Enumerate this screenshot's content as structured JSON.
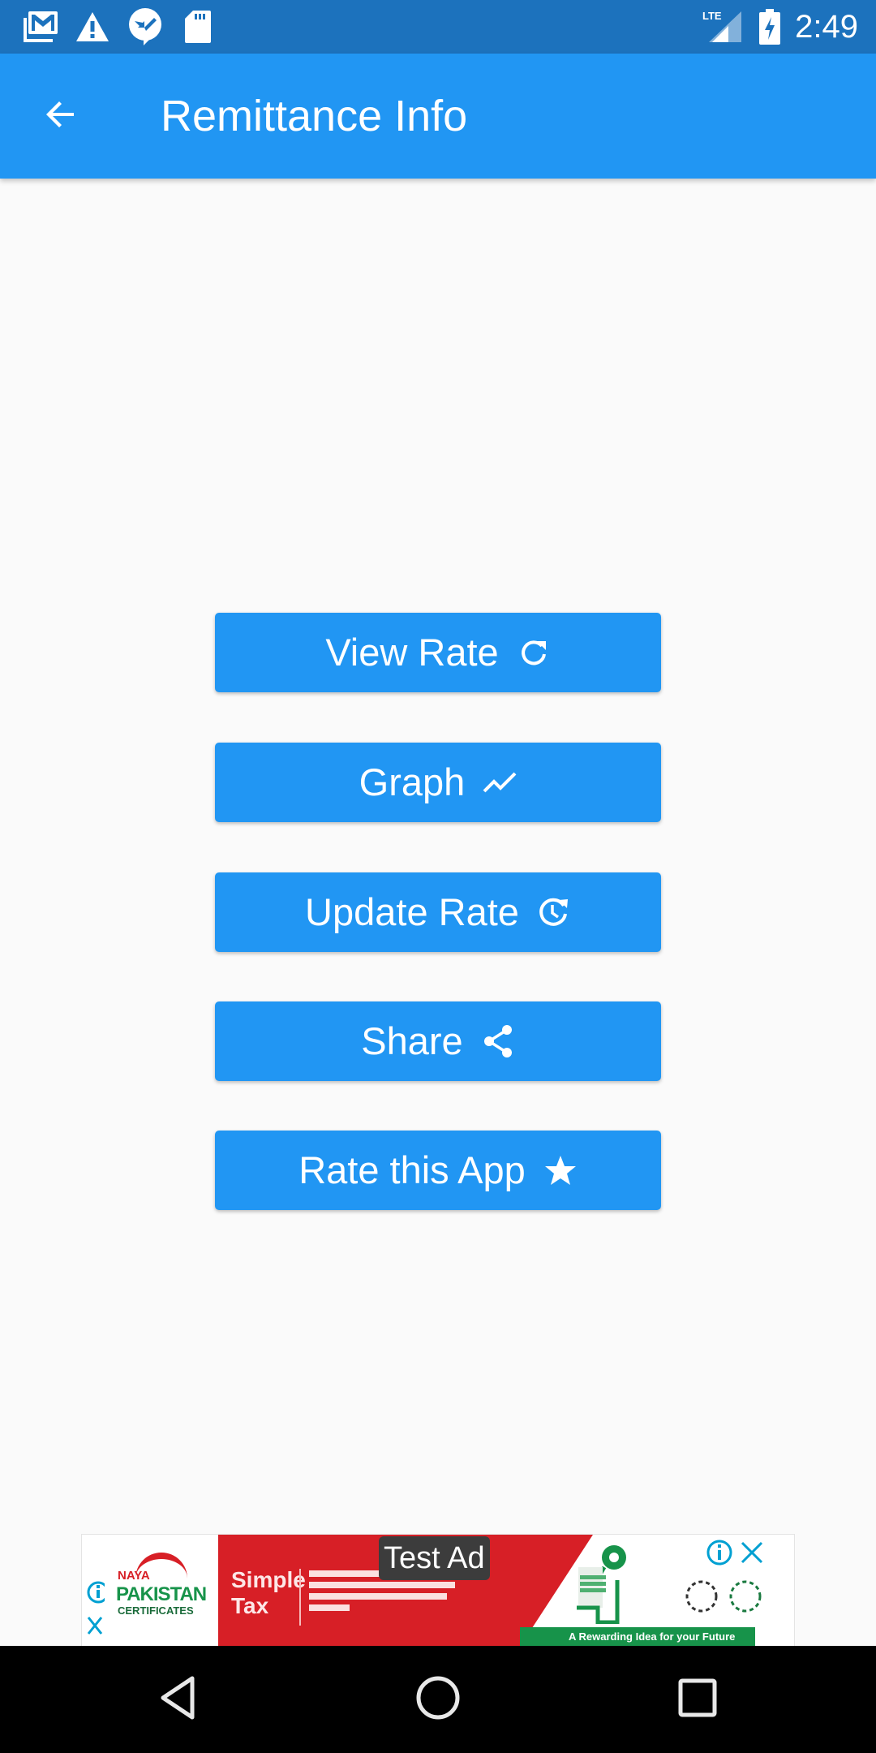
{
  "status_bar": {
    "time": "2:49",
    "network": "LTE",
    "notification_icons": [
      "gmail-icon",
      "warning-icon",
      "messenger-icon",
      "sd-card-icon"
    ],
    "system_icons": [
      "lte-signal-icon",
      "battery-charging-icon"
    ]
  },
  "app_bar": {
    "title": "Remittance Info",
    "back_icon": "arrow-back-icon"
  },
  "buttons": [
    {
      "label": "View Rate",
      "icon": "refresh-icon"
    },
    {
      "label": "Graph",
      "icon": "trending-up-icon"
    },
    {
      "label": "Update Rate",
      "icon": "update-icon"
    },
    {
      "label": "Share",
      "icon": "share-icon"
    },
    {
      "label": "Rate this App",
      "icon": "star-icon"
    }
  ],
  "ad_banner": {
    "badge": "Test Ad",
    "brand_line1": "NAYA",
    "brand_line2": "PAKISTAN",
    "brand_line3": "CERTIFICATES",
    "headline_line1": "Simple",
    "headline_line2": "Tax",
    "footer_text": "A Rewarding Idea for your Future",
    "info_icon": "info-icon",
    "close_icon": "close-icon"
  },
  "colors": {
    "primary": "#2196f3",
    "status_bar": "#1c72bd",
    "background": "#fafafa",
    "ad_red": "#d71f26",
    "ad_green": "#17934a",
    "ad_choices": "#00a0d2"
  },
  "nav_bar": {
    "buttons": [
      "back",
      "home",
      "recents"
    ]
  }
}
